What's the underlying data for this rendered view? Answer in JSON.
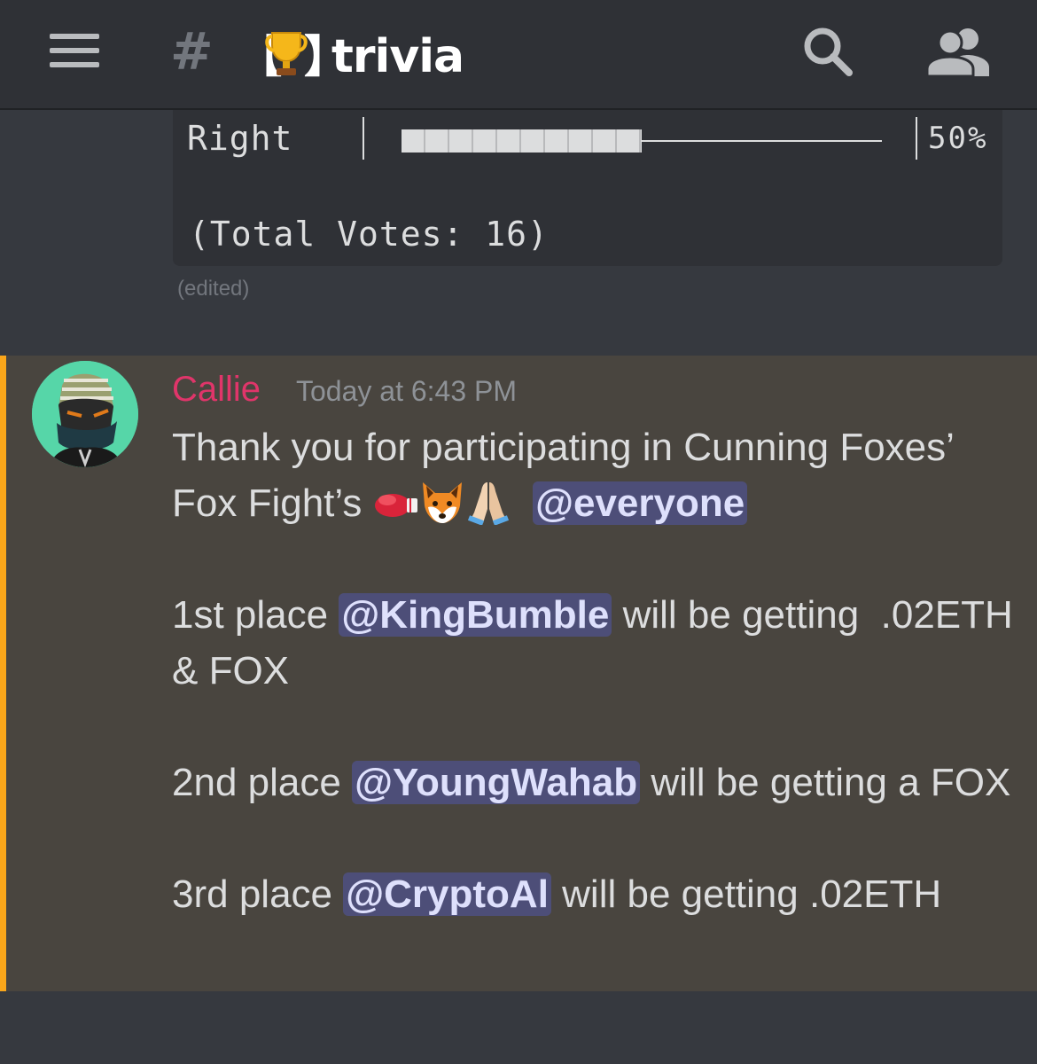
{
  "header": {
    "channel_prefix": "#",
    "channel_name": "trivia",
    "channel_emoji": "trophy"
  },
  "poll": {
    "option_label": "Right",
    "percent_text": "50%",
    "fill_fraction": 0.5,
    "total_text": "(Total Votes: 16)",
    "edited_label": "(edited)"
  },
  "message": {
    "author": "Callie",
    "author_color": "#e0356a",
    "timestamp": "Today at 6:43 PM",
    "line1": "Thank you for participating in Cunning Foxes’ Fox Fight’s",
    "emojis": [
      "boxing-glove",
      "fox",
      "folded-hands"
    ],
    "mention_everyone": "@everyone",
    "p1_prefix": "1st place ",
    "p1_mention": "@KingBumble",
    "p1_suffix": " will be getting  .02ETH & FOX",
    "p2_prefix": "2nd place ",
    "p2_mention": "@YoungWahab",
    "p2_suffix": " will be getting a FOX",
    "p3_prefix": "3rd place ",
    "p3_mention": "@CryptoAl",
    "p3_suffix": " will be getting .02ETH"
  },
  "colors": {
    "highlight_bar": "#faa61a",
    "highlight_bg": "#49453f",
    "mention_bg": "#4a4f8f"
  }
}
